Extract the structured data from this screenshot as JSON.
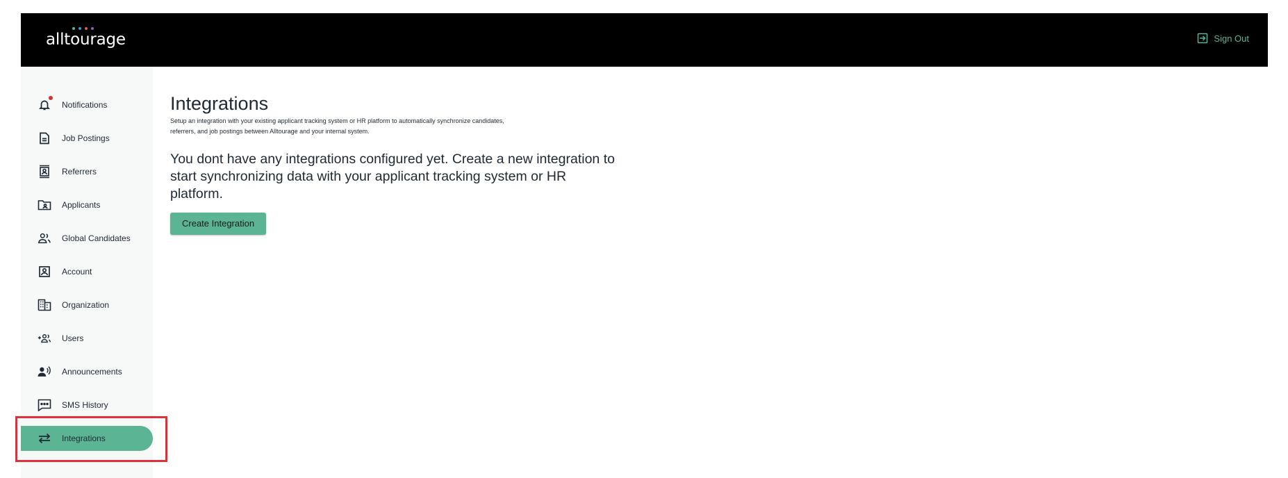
{
  "header": {
    "logo_text": "alltourage",
    "logo_dot_colors": [
      "#5bb595",
      "#4a90d9",
      "#e05a5a",
      "#9b59b6"
    ],
    "signout_label": "Sign Out",
    "signout_icon": "sign-out-icon"
  },
  "sidebar": {
    "items": [
      {
        "label": "Notifications",
        "icon": "bell-icon",
        "has_badge": true
      },
      {
        "label": "Job Postings",
        "icon": "document-icon"
      },
      {
        "label": "Referrers",
        "icon": "id-card-icon"
      },
      {
        "label": "Applicants",
        "icon": "folder-person-icon"
      },
      {
        "label": "Global Candidates",
        "icon": "people-icon"
      },
      {
        "label": "Account",
        "icon": "account-box-icon"
      },
      {
        "label": "Organization",
        "icon": "building-icon"
      },
      {
        "label": "Users",
        "icon": "add-users-icon"
      },
      {
        "label": "Announcements",
        "icon": "speaker-icon"
      },
      {
        "label": "SMS History",
        "icon": "message-icon"
      },
      {
        "label": "Integrations",
        "icon": "arrows-swap-icon",
        "active": true
      }
    ]
  },
  "main": {
    "title": "Integrations",
    "description": "Setup an integration with your existing applicant tracking system or HR platform to automatically synchronize candidates, referrers, and job postings between Alltourage and your internal system.",
    "empty_message": "You dont have any integrations configured yet. Create a new integration to start synchronizing data with your applicant tracking system or HR platform.",
    "create_button_label": "Create Integration"
  },
  "colors": {
    "accent": "#5bb595",
    "header_bg": "#000000",
    "sidebar_bg": "#f7f8f8",
    "badge": "#d9302f",
    "highlight": "#e0303a"
  }
}
